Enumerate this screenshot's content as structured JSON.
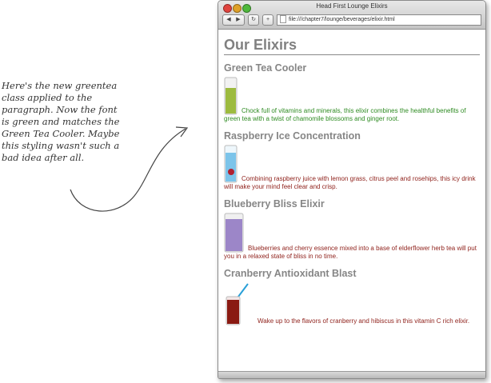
{
  "annotation": {
    "lines": [
      "Here's the new greentea",
      "class applied to the",
      "paragraph. Now the font",
      "is green and matches the",
      "Green Tea Cooler. Maybe",
      "this styling wasn't such a",
      "bad idea after all."
    ]
  },
  "window": {
    "title": "Head First Lounge Elixirs",
    "url": "file:///chapter7/lounge/beverages/elixir.html",
    "back_glyph": "◀",
    "forward_glyph": "▶",
    "reload_glyph": "↻",
    "add_glyph": "+"
  },
  "page": {
    "title": "Our Elixirs",
    "elixirs": [
      {
        "name": "Green Tea Cooler",
        "description": "Chock full of vitamins and minerals, this elixir combines the healthful benefits of green tea with a twist of chamomile blossoms and ginger root.",
        "text_color": "#2e8b22",
        "drink_color": "#9dbb3f"
      },
      {
        "name": "Raspberry Ice Concentration",
        "description": "Combining raspberry juice with lemon grass, citrus peel and rosehips, this icy drink will make your mind feel clear and crisp.",
        "text_color": "#8e1f19",
        "drink_color": "#7cc4ea"
      },
      {
        "name": "Blueberry Bliss Elixir",
        "description": "Blueberries and cherry essence mixed into a base of elderflower herb tea will put you in a relaxed state of bliss in no time.",
        "text_color": "#8e1f19",
        "drink_color": "#9c86c8"
      },
      {
        "name": "Cranberry Antioxidant Blast",
        "description": "Wake up to the flavors of cranberry and hibiscus in this vitamin C rich elixir.",
        "text_color": "#8e1f19",
        "drink_color": "#8a1a12"
      }
    ]
  }
}
